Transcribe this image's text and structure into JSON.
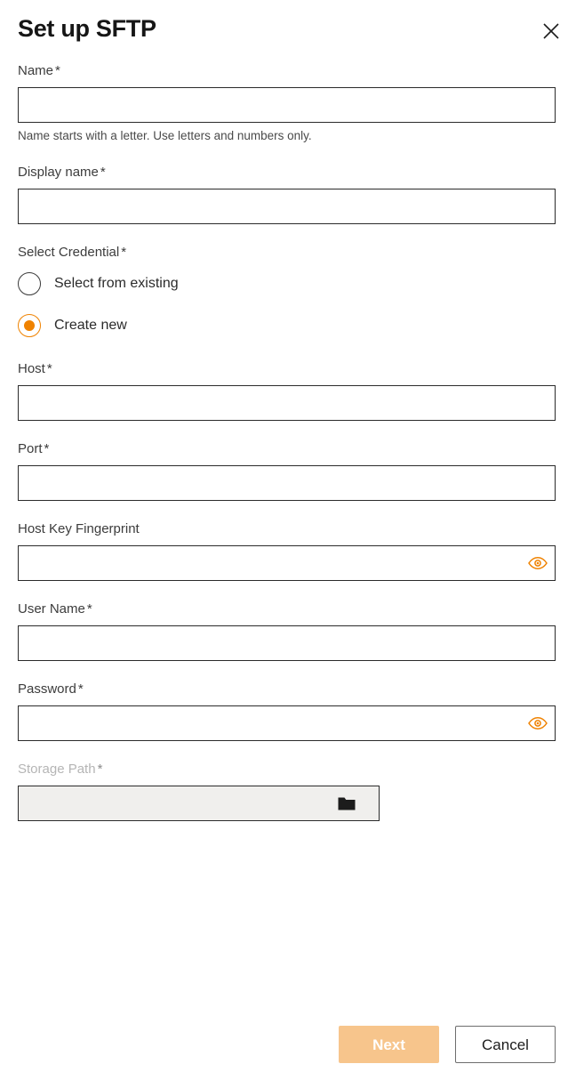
{
  "dialog": {
    "title": "Set up SFTP",
    "close_icon": "close-icon"
  },
  "fields": {
    "name": {
      "label": "Name",
      "required_mark": "*",
      "value": "",
      "placeholder": "",
      "helper": "Name starts with a letter. Use letters and numbers only."
    },
    "display_name": {
      "label": "Display name",
      "required_mark": "*",
      "value": "",
      "placeholder": ""
    },
    "select_credential": {
      "label": "Select Credential",
      "required_mark": "*",
      "options": [
        {
          "label": "Select from existing",
          "selected": false
        },
        {
          "label": "Create new",
          "selected": true
        }
      ]
    },
    "host": {
      "label": "Host",
      "required_mark": "*",
      "value": "",
      "placeholder": ""
    },
    "port": {
      "label": "Port",
      "required_mark": "*",
      "value": "",
      "placeholder": ""
    },
    "host_key_fingerprint": {
      "label": "Host Key Fingerprint",
      "required_mark": "",
      "value": "",
      "placeholder": "",
      "reveal_icon": "eye-icon"
    },
    "user_name": {
      "label": "User Name",
      "required_mark": "*",
      "value": "",
      "placeholder": ""
    },
    "password": {
      "label": "Password",
      "required_mark": "*",
      "value": "",
      "placeholder": "",
      "reveal_icon": "eye-icon"
    },
    "storage_path": {
      "label": "Storage Path",
      "required_mark": "*",
      "value": "",
      "placeholder": "",
      "disabled": true,
      "browse_icon": "folder-icon"
    }
  },
  "footer": {
    "next_label": "Next",
    "cancel_label": "Cancel"
  },
  "colors": {
    "accent_orange": "#ef8200",
    "primary_disabled": "#f7c58c",
    "border_dark": "#2b2b2b",
    "disabled_field_bg": "#f0efed",
    "disabled_label": "#b5b5b5"
  }
}
